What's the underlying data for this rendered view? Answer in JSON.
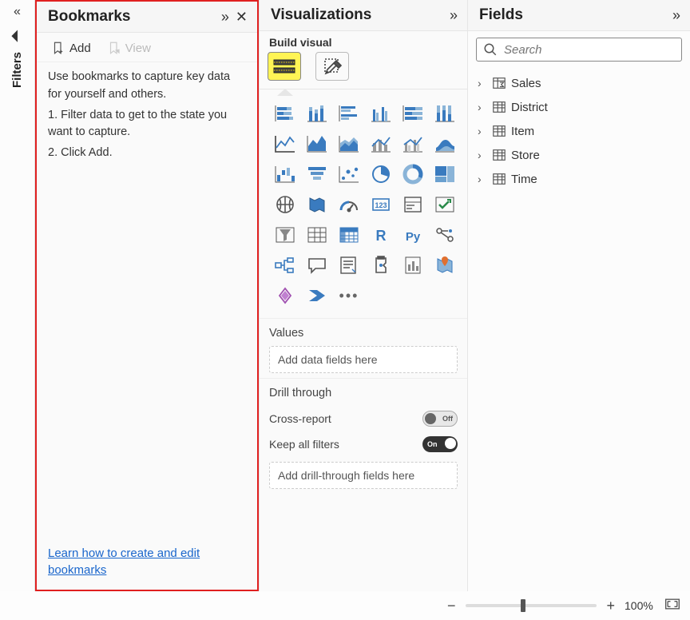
{
  "filters_rail": {
    "label": "Filters"
  },
  "bookmarks": {
    "title": "Bookmarks",
    "add_label": "Add",
    "view_label": "View",
    "intro": "Use bookmarks to capture key data for yourself and others.",
    "step1": "1. Filter data to get to the state you want to capture.",
    "step2": "2. Click Add.",
    "learn_link": "Learn how to create and edit bookmarks"
  },
  "visualizations": {
    "title": "Visualizations",
    "build_label": "Build visual",
    "values_header": "Values",
    "values_placeholder": "Add data fields here",
    "drill_header": "Drill through",
    "cross_report_label": "Cross-report",
    "cross_report_state": "Off",
    "keep_filters_label": "Keep all filters",
    "keep_filters_state": "On",
    "drill_placeholder": "Add drill-through fields here"
  },
  "fields": {
    "title": "Fields",
    "search_placeholder": "Search",
    "tables": [
      {
        "name": "Sales",
        "icon": "sigma"
      },
      {
        "name": "District",
        "icon": "table"
      },
      {
        "name": "Item",
        "icon": "table"
      },
      {
        "name": "Store",
        "icon": "table"
      },
      {
        "name": "Time",
        "icon": "table"
      }
    ]
  },
  "zoom": {
    "level": "100%"
  }
}
